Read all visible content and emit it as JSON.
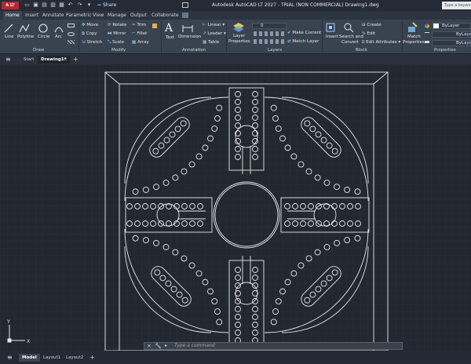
{
  "titlebar": {
    "app_badge": "A LT",
    "share": "Share",
    "title": "Autodesk AutoCAD LT 2027 - TRIAL (NON COMMERCIAL)   Drawing1.dwg",
    "search_placeholder": "Type a keyword"
  },
  "ribbon_tabs": [
    "Home",
    "Insert",
    "Annotate",
    "Parametric",
    "View",
    "Manage",
    "Output",
    "Collaborate"
  ],
  "ribbon": {
    "draw": {
      "line": "Line",
      "polyline": "Polyline",
      "circle": "Circle",
      "arc": "Arc",
      "title": "Draw"
    },
    "modify": {
      "move": "Move",
      "rotate": "Rotate",
      "trim": "Trim",
      "copy": "Copy",
      "mirror": "Mirror",
      "fillet": "Fillet",
      "stretch": "Stretch",
      "scale": "Scale",
      "array": "Array",
      "title": "Modify"
    },
    "annotation": {
      "text": "Text",
      "dimension": "Dimension",
      "linear": "Linear",
      "leader": "Leader",
      "table": "Table",
      "title": "Annotation"
    },
    "layers": {
      "layer_properties_1": "Layer",
      "layer_properties_2": "Properties",
      "layer_value": "0",
      "make_current": "Make Current",
      "match_layer": "Match Layer",
      "title": "Layers"
    },
    "block": {
      "insert": "Insert",
      "search_1": "Search and",
      "search_2": "Convert",
      "create": "Create",
      "edit": "Edit",
      "edit_attributes": "Edit Attributes",
      "title": "Block"
    },
    "properties": {
      "match_1": "Match",
      "match_2": "Properties",
      "color": "ByLayer",
      "linetype": "ByLayer",
      "lineweight": "ByLayer",
      "title": "Properties"
    }
  },
  "doc_tabs": {
    "start": "Start",
    "drawing": "Drawing1*"
  },
  "command": {
    "placeholder": "Type a command"
  },
  "ucs": {
    "x": "X",
    "y": "Y"
  },
  "status_tabs": [
    "Model",
    "Layout1",
    "Layout2"
  ],
  "colors": {
    "accent": "#b5282e",
    "canvas": "#212830",
    "geometry": "#e6e9ee"
  }
}
